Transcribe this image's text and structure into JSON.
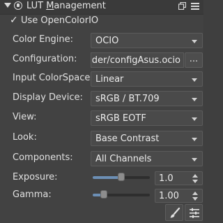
{
  "header": {
    "title_prefix": "LUT ",
    "title_underlined": "M",
    "title_rest": "anagement",
    "collapse_icon": "triangle-down-icon",
    "plugin_icon": "lock-circle-icon",
    "float_icon": "float-window-icon",
    "close_icon": "grip-close-icon"
  },
  "use_ocio": {
    "checked": true,
    "check_glyph": "✓",
    "label": "Use OpenColorIO"
  },
  "color_engine": {
    "label": "Color Engine:",
    "value": "OCIO"
  },
  "configuration": {
    "label": "Configuration:",
    "value": "nder/configAsus.ocio",
    "browse_label": "..."
  },
  "input_colorspace": {
    "label": "Input ColorSpace:",
    "value": "Linear"
  },
  "display_device": {
    "label": "Display Device:",
    "value": "sRGB / BT.709"
  },
  "view": {
    "label": "View:",
    "value": "sRGB EOTF"
  },
  "look": {
    "label": "Look:",
    "value": "Base Contrast"
  },
  "components": {
    "label": "Components:",
    "value": "All Channels"
  },
  "exposure": {
    "label": "Exposure:",
    "value": "1.0",
    "level": 0.5
  },
  "gamma": {
    "label": "Gamma:",
    "value": "1.00",
    "level": 0.2
  },
  "bottom_buttons": {
    "left_icon": "brush-icon",
    "right_icon": "sliders-menu-icon"
  },
  "colors": {
    "accent": "#6c8fb5",
    "panel_bg": "#424242",
    "field_bg": "#4a4a4a"
  }
}
